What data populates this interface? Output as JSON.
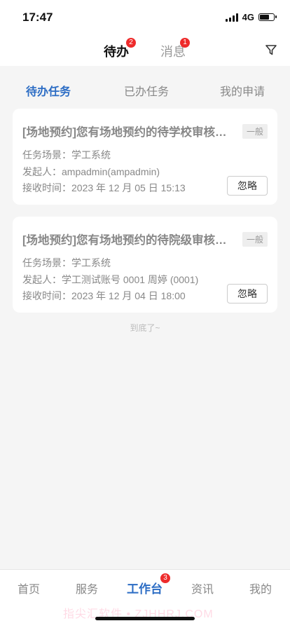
{
  "status_bar": {
    "time": "17:47",
    "network": "4G",
    "battery_level": 0.75
  },
  "top_nav": {
    "tabs": [
      {
        "label": "待办",
        "badge": "2",
        "active": true
      },
      {
        "label": "消息",
        "badge": "1",
        "active": false
      }
    ],
    "filter_icon": "filter-icon"
  },
  "sub_tabs": [
    {
      "label": "待办任务",
      "active": true
    },
    {
      "label": "已办任务",
      "active": false
    },
    {
      "label": "我的申请",
      "active": false
    }
  ],
  "tasks": [
    {
      "title": "[场地预约]您有场地预约的待学校审核事项",
      "tag": "一般",
      "scene_label": "任务场景：",
      "scene": "学工系统",
      "sender_label": "发起人：",
      "sender": "ampadmin(ampadmin)",
      "time_label": "接收时间：",
      "time": "2023 年 12 月 05 日 15:13",
      "button": "忽略"
    },
    {
      "title": "[场地预约]您有场地预约的待院级审核事项",
      "tag": "一般",
      "scene_label": "任务场景：",
      "scene": "学工系统",
      "sender_label": "发起人：",
      "sender": "学工测试账号 0001 周婷 (0001)",
      "time_label": "接收时间：",
      "time": "2023 年 12 月 04 日 18:00",
      "button": "忽略"
    }
  ],
  "end_note": "到底了~",
  "tab_bar": {
    "items": [
      {
        "label": "首页",
        "active": false
      },
      {
        "label": "服务",
        "active": false
      },
      {
        "label": "工作台",
        "active": true,
        "badge": "3"
      },
      {
        "label": "资讯",
        "active": false
      },
      {
        "label": "我的",
        "active": false
      }
    ]
  },
  "watermark": "指尖汇软件 • ZJHHRJ.COM",
  "colors": {
    "accent": "#2b6cc4",
    "badge": "#ee2b2b",
    "background": "#f5f5f5"
  }
}
